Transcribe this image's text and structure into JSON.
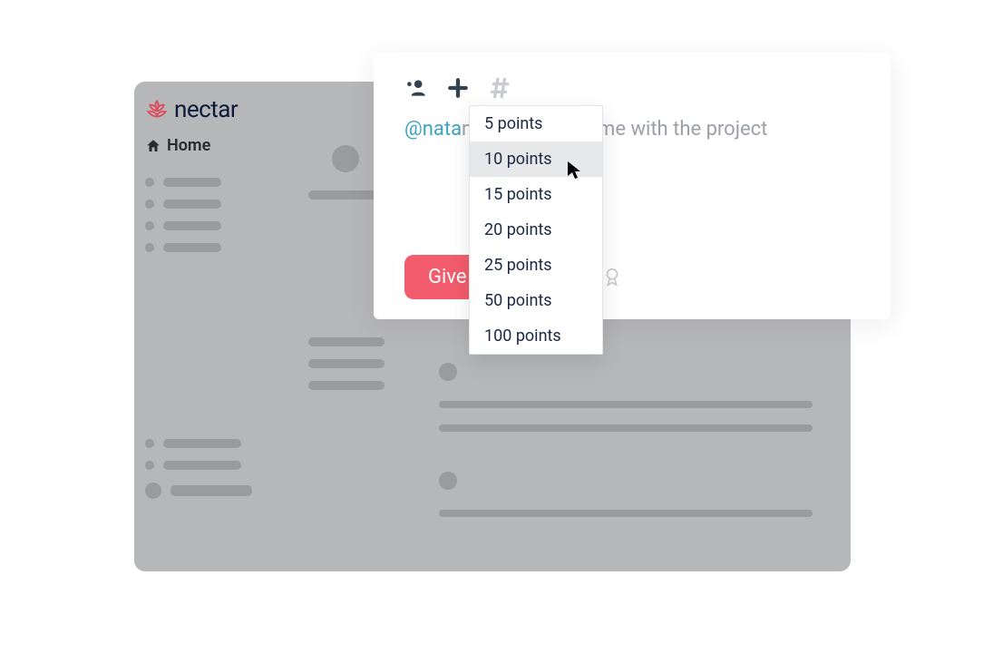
{
  "brand": {
    "name": "nectar"
  },
  "nav": {
    "home_label": "Home"
  },
  "compose": {
    "mention": "@nata",
    "body_tail": "nks for helping me with the project",
    "give_label": "Give"
  },
  "points_dropdown": {
    "options": [
      "5 points",
      "10 points",
      "15 points",
      "20 points",
      "25 points",
      "50 points",
      "100 points"
    ],
    "hovered_index": 1
  }
}
